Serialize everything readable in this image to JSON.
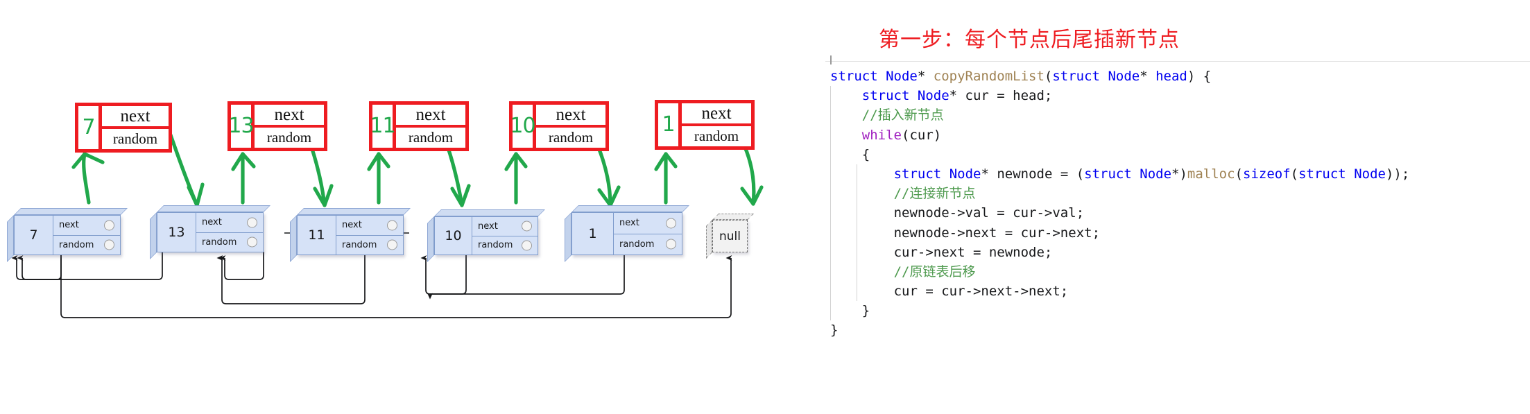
{
  "diagram": {
    "copy_nodes": [
      {
        "value": "7",
        "next_label": "next",
        "random_label": "random"
      },
      {
        "value": "13",
        "next_label": "next",
        "random_label": "random"
      },
      {
        "value": "11",
        "next_label": "next",
        "random_label": "random"
      },
      {
        "value": "10",
        "next_label": "next",
        "random_label": "random"
      },
      {
        "value": "1",
        "next_label": "next",
        "random_label": "random"
      }
    ],
    "original_nodes": [
      {
        "value": "7",
        "next_label": "next",
        "random_label": "random"
      },
      {
        "value": "13",
        "next_label": "next",
        "random_label": "random"
      },
      {
        "value": "11",
        "next_label": "next",
        "random_label": "random"
      },
      {
        "value": "10",
        "next_label": "next",
        "random_label": "random"
      },
      {
        "value": "1",
        "next_label": "next",
        "random_label": "random"
      }
    ],
    "terminator": {
      "label": "null"
    },
    "colors": {
      "copy_border": "#ee1c21",
      "handwriting": "#21a84b",
      "node_fill": "#d6e2f7",
      "node_border": "#7f9ccc",
      "pointer_line": "#17181a",
      "null_fill": "#f2f2f2"
    },
    "random_pointers": [
      {
        "from": "7",
        "to": "7"
      },
      {
        "from": "13",
        "to": "7"
      },
      {
        "from": "11",
        "to": "11"
      },
      {
        "from": "10",
        "to": "11"
      },
      {
        "from": "1",
        "to": "7"
      },
      {
        "from": "null",
        "to": "null"
      }
    ]
  },
  "code": {
    "title": "第一步：每个节点后尾插新节点",
    "title_color": "#ee1c21",
    "lines": [
      {
        "indent": 0,
        "guides": 0,
        "tokens": [
          {
            "t": "struct",
            "c": "kw"
          },
          {
            "t": " ",
            "c": "pn"
          },
          {
            "t": "Node",
            "c": "kw"
          },
          {
            "t": "* ",
            "c": "pn"
          },
          {
            "t": "copyRandomList",
            "c": "fn"
          },
          {
            "t": "(",
            "c": "pn"
          },
          {
            "t": "struct",
            "c": "kw"
          },
          {
            "t": " ",
            "c": "pn"
          },
          {
            "t": "Node",
            "c": "kw"
          },
          {
            "t": "* ",
            "c": "pn"
          },
          {
            "t": "head",
            "c": "kw"
          },
          {
            "t": ") {",
            "c": "pn"
          }
        ]
      },
      {
        "indent": 1,
        "guides": 1,
        "tokens": [
          {
            "t": "struct",
            "c": "kw"
          },
          {
            "t": " ",
            "c": "pn"
          },
          {
            "t": "Node",
            "c": "kw"
          },
          {
            "t": "* cur = head;",
            "c": "pn"
          }
        ]
      },
      {
        "indent": 1,
        "guides": 1,
        "tokens": [
          {
            "t": "//插入新节点",
            "c": "cm"
          }
        ]
      },
      {
        "indent": 1,
        "guides": 1,
        "tokens": [
          {
            "t": "while",
            "c": "pl"
          },
          {
            "t": "(cur)",
            "c": "pn"
          }
        ]
      },
      {
        "indent": 1,
        "guides": 1,
        "tokens": [
          {
            "t": "{",
            "c": "pn"
          }
        ]
      },
      {
        "indent": 2,
        "guides": 2,
        "tokens": [
          {
            "t": "struct",
            "c": "kw"
          },
          {
            "t": " ",
            "c": "pn"
          },
          {
            "t": "Node",
            "c": "kw"
          },
          {
            "t": "* newnode = (",
            "c": "pn"
          },
          {
            "t": "struct",
            "c": "kw"
          },
          {
            "t": " ",
            "c": "pn"
          },
          {
            "t": "Node",
            "c": "kw"
          },
          {
            "t": "*)",
            "c": "pn"
          },
          {
            "t": "malloc",
            "c": "fn"
          },
          {
            "t": "(",
            "c": "pn"
          },
          {
            "t": "sizeof",
            "c": "kw"
          },
          {
            "t": "(",
            "c": "pn"
          },
          {
            "t": "struct",
            "c": "kw"
          },
          {
            "t": " ",
            "c": "pn"
          },
          {
            "t": "Node",
            "c": "kw"
          },
          {
            "t": "));",
            "c": "pn"
          }
        ]
      },
      {
        "indent": 2,
        "guides": 2,
        "tokens": [
          {
            "t": "//连接新节点",
            "c": "cm"
          }
        ]
      },
      {
        "indent": 2,
        "guides": 2,
        "tokens": [
          {
            "t": "newnode->val = cur->val;",
            "c": "pn"
          }
        ]
      },
      {
        "indent": 2,
        "guides": 2,
        "tokens": [
          {
            "t": "newnode->next = cur->next;",
            "c": "pn"
          }
        ]
      },
      {
        "indent": 2,
        "guides": 2,
        "tokens": [
          {
            "t": "cur->next = newnode;",
            "c": "pn"
          }
        ]
      },
      {
        "indent": 2,
        "guides": 2,
        "tokens": [
          {
            "t": "//原链表后移",
            "c": "cm"
          }
        ]
      },
      {
        "indent": 2,
        "guides": 2,
        "tokens": [
          {
            "t": "cur = cur->next->next;",
            "c": "pn"
          }
        ]
      },
      {
        "indent": 1,
        "guides": 1,
        "tokens": [
          {
            "t": "}",
            "c": "pn"
          }
        ]
      },
      {
        "indent": 0,
        "guides": 0,
        "tokens": [
          {
            "t": "}",
            "c": "pn"
          }
        ]
      }
    ]
  }
}
